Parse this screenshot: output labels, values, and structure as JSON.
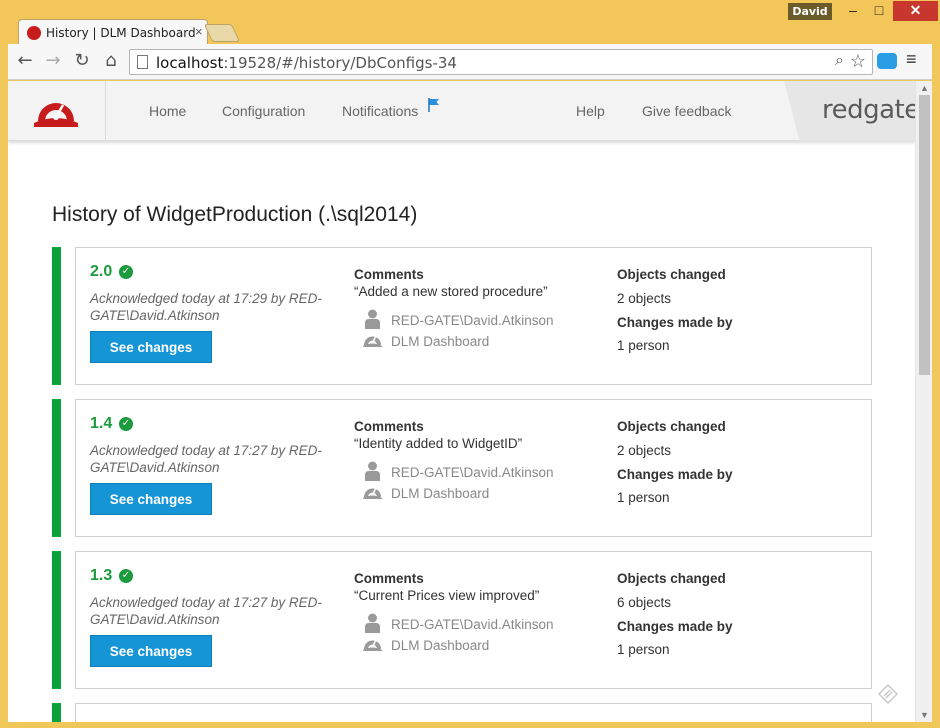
{
  "window": {
    "user": "David",
    "minimize_glyph": "–",
    "maximize_glyph": "□",
    "close_glyph": "✕"
  },
  "tab": {
    "title": "History | DLM Dashboard",
    "close_glyph": "×"
  },
  "toolbar": {
    "back_glyph": "←",
    "forward_glyph": "→",
    "reload_glyph": "↻",
    "home_glyph": "⌂",
    "url_host": "localhost",
    "url_rest": ":19528/#/history/DbConfigs-34",
    "search_glyph": "⌕",
    "star_glyph": "☆",
    "menu_glyph": "≡"
  },
  "header": {
    "nav": {
      "home": "Home",
      "configuration": "Configuration",
      "notifications": "Notifications",
      "help": "Help",
      "feedback": "Give feedback"
    },
    "brand": "redgate"
  },
  "page": {
    "title": "History of WidgetProduction (.\\sql2014)"
  },
  "labels": {
    "comments": "Comments",
    "objects_changed": "Objects changed",
    "changes_made_by": "Changes made by",
    "see_changes": "See changes"
  },
  "colors": {
    "accent_green": "#0aa33b",
    "button_blue": "#1594d6",
    "brand_red": "#c81c1c"
  },
  "entries": [
    {
      "version": "2.0",
      "acknowledged": "Acknowledged today at 17:29 by RED-GATE\\David.Atkinson",
      "comment": "“Added a new stored procedure”",
      "user": "RED-GATE\\David.Atkinson",
      "source": "DLM Dashboard",
      "objects": "2 objects",
      "people": "1 person"
    },
    {
      "version": "1.4",
      "acknowledged": "Acknowledged today at 17:27 by RED-GATE\\David.Atkinson",
      "comment": "“Identity added to WidgetID”",
      "user": "RED-GATE\\David.Atkinson",
      "source": "DLM Dashboard",
      "objects": "2 objects",
      "people": "1 person"
    },
    {
      "version": "1.3",
      "acknowledged": "Acknowledged today at 17:27 by RED-GATE\\David.Atkinson",
      "comment": "“Current Prices view improved”",
      "user": "RED-GATE\\David.Atkinson",
      "source": "DLM Dashboard",
      "objects": "6 objects",
      "people": "1 person"
    }
  ]
}
